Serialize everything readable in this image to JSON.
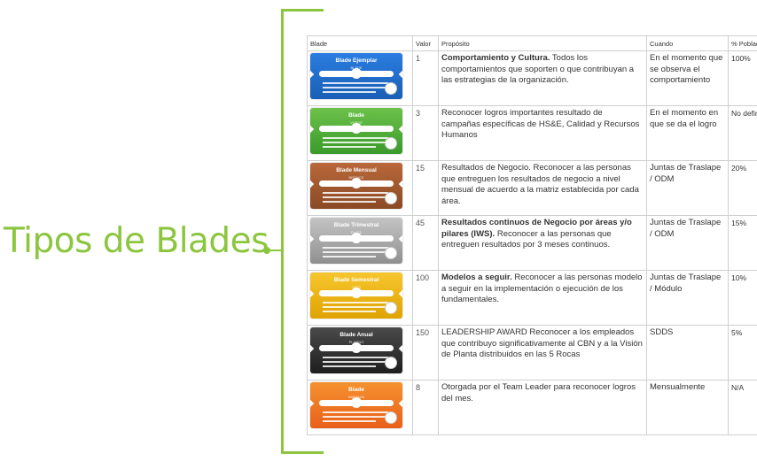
{
  "title": "Tipos de Blades",
  "columns": {
    "blade": "Blade",
    "valor": "Valor",
    "proposito": "Propósito",
    "cuando": "Cuando",
    "poblacion": "% Población"
  },
  "rows": [
    {
      "blade_name": "Blade Ejemplar",
      "blade_tag": "BLADE",
      "blade_color": "#1a5fb4",
      "blade_color2": "#2a7de1",
      "valor": "1",
      "purpose_bold": "Comportamiento y Cultura.",
      "purpose_rest": " Todos los comportamientos que soporten o que contribuyan a las estrategias de la organización.",
      "cuando": "En el momento que se observa el comportamiento",
      "poblacion": "100%"
    },
    {
      "blade_name": "Blade",
      "blade_tag": "VERDE",
      "blade_color": "#3a9a2a",
      "blade_color2": "#6cc24a",
      "valor": "3",
      "purpose_bold": "",
      "purpose_rest": "Reconocer logros importantes resultado de campañas específicas de HS&E, Calidad y Recursos Humanos",
      "cuando": "En el momento en que se da el logro",
      "poblacion": "No definida"
    },
    {
      "blade_name": "Blade Mensual",
      "blade_tag": "BRONCE",
      "blade_color": "#8a4a25",
      "blade_color2": "#b9683a",
      "valor": "15",
      "purpose_bold": "",
      "purpose_rest": "Resultados de Negocio. Reconocer a las personas que entreguen los resultados de negocio a nivel mensual de acuerdo a la matriz establecida por cada área.",
      "cuando": "Juntas de Traslape / ODM",
      "poblacion": "20%"
    },
    {
      "blade_name": "Blade Trimestral",
      "blade_tag": "PLATA",
      "blade_color": "#8f8f8f",
      "blade_color2": "#c4c4c4",
      "valor": "45",
      "purpose_bold": "Resultados continuos de Negocio por áreas y/o pilares (IWS).",
      "purpose_rest": " Reconocer a las personas que entreguen resultados por 3 meses continuos.",
      "cuando": "Juntas de Traslape / ODM",
      "poblacion": "15%"
    },
    {
      "blade_name": "Blade Semestral",
      "blade_tag": "ORO",
      "blade_color": "#e0a300",
      "blade_color2": "#f6c62f",
      "valor": "100",
      "purpose_bold": "Modelos a seguir.",
      "purpose_rest": " Reconocer a las personas modelo a seguir en la implementación o ejecución de los fundamentales.",
      "cuando": "Juntas de Traslape / Módulo",
      "poblacion": "10%"
    },
    {
      "blade_name": "Blade Anual",
      "blade_tag": "PLATINO",
      "blade_color": "#1e1e1e",
      "blade_color2": "#4a4a4a",
      "valor": "150",
      "purpose_bold": "",
      "purpose_rest": "LEADERSHIP AWARD Reconocer a los empleados que contribuyo significativamente al CBN y a la Visión de Planta distribuidos en las 5 Rocas",
      "cuando": "SDDS",
      "poblacion": "5%"
    },
    {
      "blade_name": "Blade",
      "blade_tag": "NARANJA",
      "blade_color": "#e8601a",
      "blade_color2": "#f5912f",
      "valor": "8",
      "purpose_bold": "",
      "purpose_rest": "Otorgada por el Team Leader para reconocer logros del mes.",
      "cuando": "Mensualmente",
      "poblacion": "N/A"
    }
  ]
}
